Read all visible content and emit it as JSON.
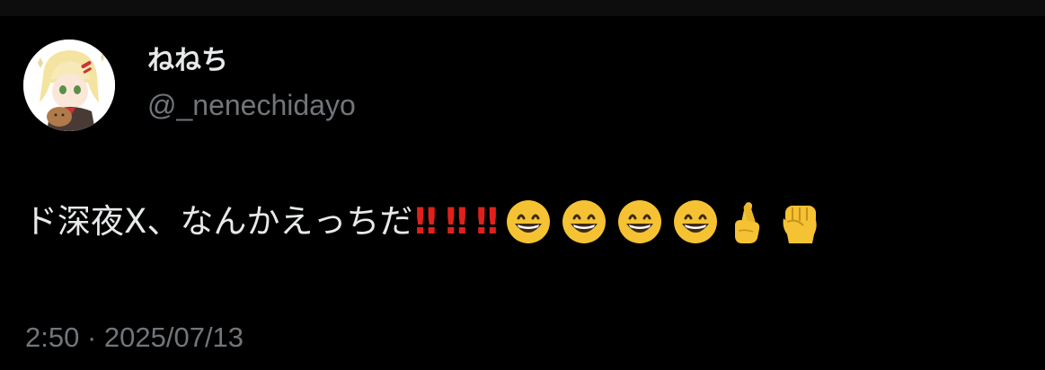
{
  "post": {
    "author": {
      "display_name": "ねねち",
      "handle": "@_nenechidayo"
    },
    "text": "ド深夜X、なんかえっちだ",
    "reaction_emojis": [
      {
        "glyph": "‼",
        "icon": "double-exclamation"
      },
      {
        "glyph": "‼",
        "icon": "double-exclamation"
      },
      {
        "glyph": "‼",
        "icon": "double-exclamation"
      },
      {
        "glyph": "😄",
        "icon": "grinning-face"
      },
      {
        "glyph": "😄",
        "icon": "grinning-face"
      },
      {
        "glyph": "😄",
        "icon": "grinning-face"
      },
      {
        "glyph": "😄",
        "icon": "grinning-face"
      },
      {
        "glyph": "🤞",
        "icon": "crossed-fingers"
      },
      {
        "glyph": "✊",
        "icon": "raised-fist"
      }
    ],
    "timestamp": "2:50 · 2025/07/13"
  },
  "colors": {
    "background": "#000000",
    "primary_text": "#e7e9ea",
    "secondary_text": "#71767b",
    "exclamation": "#e0211b",
    "emoji_yellow": "#f5c233"
  }
}
